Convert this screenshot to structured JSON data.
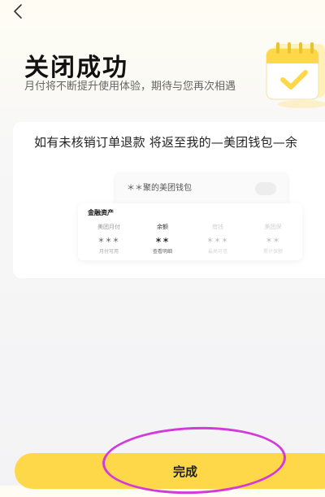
{
  "nav": {
    "back_icon": "chevron-left-icon"
  },
  "header": {
    "title": "关闭成功",
    "subtitle": "月付将不断提升使用体验，期待与您再次相遇",
    "illustration_icon": "calendar-check-icon"
  },
  "notice": {
    "text": "如有未核销订单退款 将返至我的—美团钱包—余"
  },
  "illustration": {
    "wallet_name": "＊＊聚的美团钱包",
    "section_title": "金融资产",
    "assets": [
      {
        "label": "美团月付",
        "value": "＊＊＊",
        "sub": "月付可用"
      },
      {
        "label": "余额",
        "value": "＊＊",
        "sub": "查看明细"
      },
      {
        "label": "借钱",
        "value": "＊＊＊",
        "sub": "最高可借"
      },
      {
        "label": "美团保",
        "value": "＊＊",
        "sub": "累计保额"
      }
    ]
  },
  "footer": {
    "done_label": "完成"
  },
  "colors": {
    "accent": "#ffd84a",
    "highlight": "#d23bd9"
  }
}
